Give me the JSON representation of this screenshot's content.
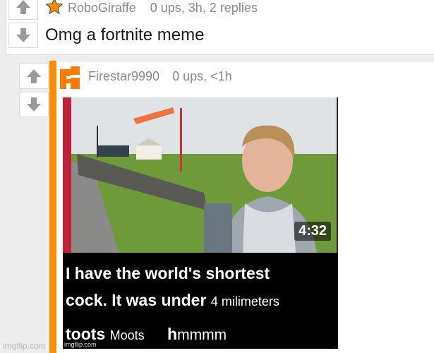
{
  "comment": {
    "username": "RoboGiraffe",
    "meta": "0 ups, 3h, 2 replies",
    "body": "Omg a fortnite meme",
    "avatar_icon": "star-icon"
  },
  "reply": {
    "username": "Firestar9990",
    "meta": "0 ups, <1h",
    "avatar_icon": "flag-icon",
    "image": {
      "duration": "4:32",
      "caption_line1": "I have  the world's shortest",
      "caption_line2_a": "cock",
      "caption_line2_b": ". It was under ",
      "caption_line2_c": "4 milim",
      "caption_line2_d": "eters",
      "caption_line3_a": "toots ",
      "caption_line3_b": "Moots",
      "caption_line3_c": "h",
      "caption_line3_d": "mmmm",
      "watermark": "imgflip.com"
    }
  },
  "footer_watermark": "imgflip.com",
  "colors": {
    "accent": "#ff8c00",
    "star": "#ff8c00",
    "background": "#ededed"
  }
}
